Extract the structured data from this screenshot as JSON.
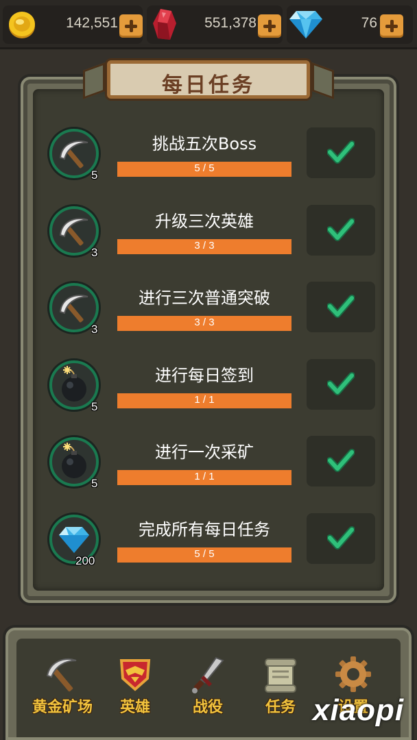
{
  "resources": [
    {
      "name": "gold-coin-icon",
      "value": "142,551"
    },
    {
      "name": "ruby-icon",
      "value": "551,378"
    },
    {
      "name": "diamond-icon",
      "value": "76"
    }
  ],
  "panel": {
    "title": "每日任务"
  },
  "tasks": [
    {
      "name": "挑战五次Boss",
      "reward_icon": "pickaxe-icon",
      "reward": "5",
      "progress": "5 / 5",
      "fraction": 1.0
    },
    {
      "name": "升级三次英雄",
      "reward_icon": "pickaxe-icon",
      "reward": "3",
      "progress": "3 / 3",
      "fraction": 1.0
    },
    {
      "name": "进行三次普通突破",
      "reward_icon": "pickaxe-icon",
      "reward": "3",
      "progress": "3 / 3",
      "fraction": 1.0
    },
    {
      "name": "进行每日签到",
      "reward_icon": "bomb-icon",
      "reward": "5",
      "progress": "1 / 1",
      "fraction": 1.0
    },
    {
      "name": "进行一次采矿",
      "reward_icon": "bomb-icon",
      "reward": "5",
      "progress": "1 / 1",
      "fraction": 1.0
    },
    {
      "name": "完成所有每日任务",
      "reward_icon": "diamond-icon",
      "reward": "200",
      "progress": "5 / 5",
      "fraction": 1.0
    }
  ],
  "nav": [
    {
      "label": "黄金矿场",
      "icon": "pickaxe-icon"
    },
    {
      "label": "英雄",
      "icon": "hero-emblem-icon"
    },
    {
      "label": "战役",
      "icon": "sword-icon"
    },
    {
      "label": "任务",
      "icon": "scroll-icon"
    },
    {
      "label": "设置",
      "icon": "gear-icon"
    }
  ],
  "watermark": "xiaopi"
}
